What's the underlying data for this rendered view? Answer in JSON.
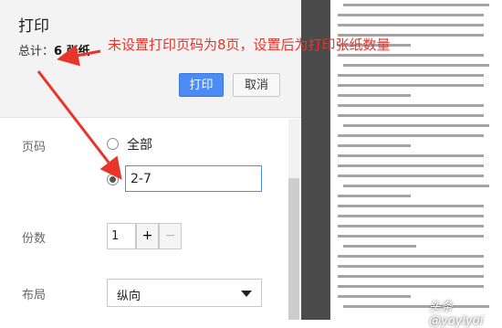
{
  "dialog": {
    "title": "打印",
    "total_prefix": "总计：",
    "total_value": "6 张纸",
    "print_label": "打印",
    "cancel_label": "取消"
  },
  "pages": {
    "label": "页码",
    "option_all": "全部",
    "custom_value": "2-7"
  },
  "copies": {
    "label": "份数",
    "value": "1",
    "plus": "+",
    "minus": "−"
  },
  "layout": {
    "label": "布局",
    "selected": "纵向"
  },
  "annotation": {
    "text": "未设置打印页码为8页，设置后为打印张纸数量",
    "color": "#e8352c"
  },
  "watermark": "头条 @yoyiyoi",
  "colors": {
    "accent": "#4d8df3",
    "preview_bg": "#4b4b4b"
  }
}
